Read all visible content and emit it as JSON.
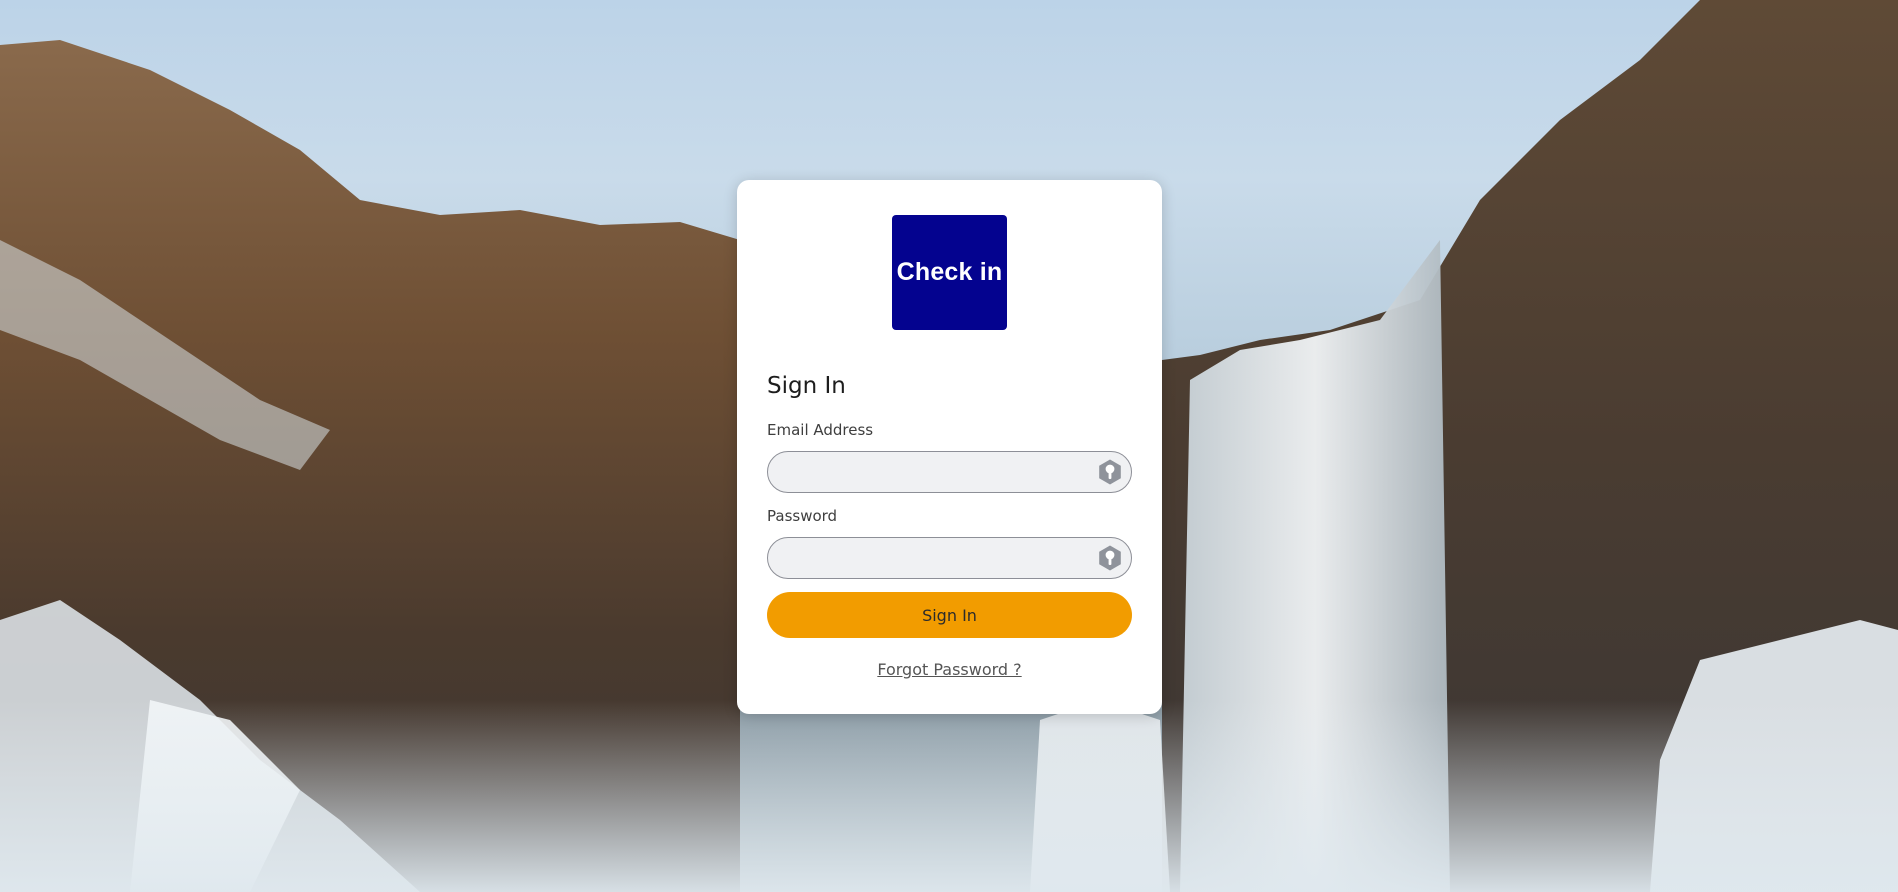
{
  "logo": {
    "text": "Check in",
    "bg_color": "#04038f"
  },
  "form": {
    "title": "Sign In",
    "email_label": "Email Address",
    "email_value": "",
    "password_label": "Password",
    "password_value": "",
    "submit_label": "Sign In",
    "submit_color": "#f29c00",
    "forgot_label": "Forgot Password ?"
  },
  "icons": {
    "field_icon": "key-icon"
  },
  "background": {
    "description_colors": [
      "#bcd3e8",
      "#7a5a3c",
      "#e8eef2"
    ]
  }
}
